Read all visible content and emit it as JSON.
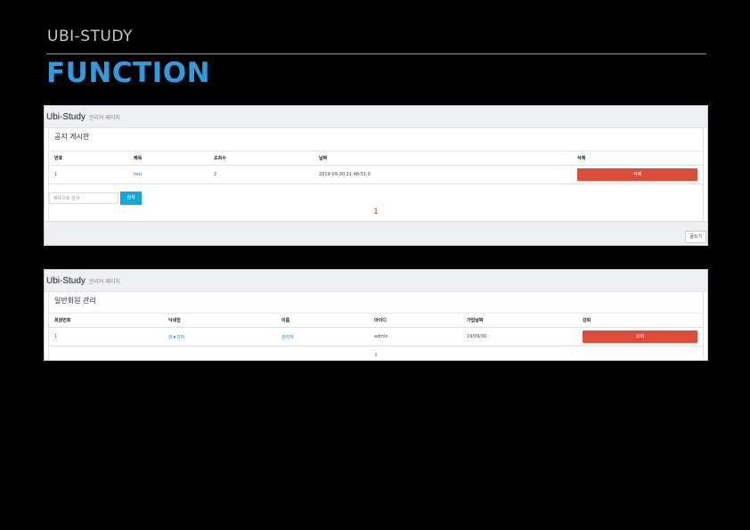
{
  "slide": {
    "eyebrow": "UBI-STUDY",
    "headline": "FUNCTION"
  },
  "shot1": {
    "brand": "Ubi-Study",
    "sub": "관리자 페이지",
    "panel_title": "공지 게시판",
    "columns": [
      "번호",
      "제목",
      "조회수",
      "날짜",
      "삭제"
    ],
    "rows": [
      {
        "no": "1",
        "title": "test",
        "views": "2",
        "date": "2019-09-30 21:48:51.0",
        "action": "삭제"
      }
    ],
    "search_placeholder": "제목으로 검색",
    "search_label": "검색",
    "page": "1",
    "write_label": "글쓰기"
  },
  "shot2": {
    "brand": "Ubi-Study",
    "sub": "관리자 페이지",
    "panel_title": "일반회원 관리",
    "columns": [
      "회원번호",
      "닉네임",
      "이름",
      "아이디",
      "가입날짜",
      "강퇴"
    ],
    "rows": [
      {
        "no": "1",
        "nickname": "관★리자",
        "name": "관리자",
        "id": "admin",
        "joined": "19/09/30",
        "action": "강퇴"
      }
    ],
    "page": "1"
  },
  "colors": {
    "accent": "#2d9de0",
    "danger": "#dd4b39",
    "search": "#12a8dc"
  }
}
